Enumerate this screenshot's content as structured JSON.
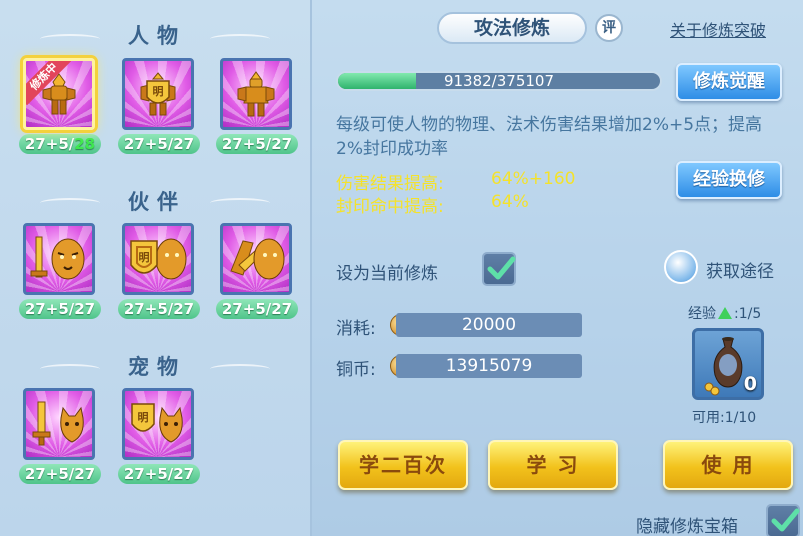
{
  "left": {
    "sections": [
      {
        "title": "人物",
        "items": [
          {
            "level_prefix": "27+5/",
            "level_suffix": "28",
            "badge": "修炼中",
            "selected": true,
            "icon": "warrior-icon"
          },
          {
            "level_prefix": "27+5/",
            "level_suffix": "27",
            "icon": "shield-warrior-icon"
          },
          {
            "level_prefix": "27+5/",
            "level_suffix": "27",
            "icon": "armor-warrior-icon"
          }
        ]
      },
      {
        "title": "伙伴",
        "items": [
          {
            "level_prefix": "27+5/",
            "level_suffix": "27",
            "icon": "tiger-sword-icon"
          },
          {
            "level_prefix": "27+5/",
            "level_suffix": "27",
            "icon": "tiger-shield-icon"
          },
          {
            "level_prefix": "27+5/",
            "level_suffix": "27",
            "icon": "tiger-gauntlet-icon"
          }
        ]
      },
      {
        "title": "宠物",
        "items": [
          {
            "level_prefix": "27+5/",
            "level_suffix": "27",
            "icon": "cat-sword-icon"
          },
          {
            "level_prefix": "27+5/",
            "level_suffix": "27",
            "icon": "cat-shield-icon"
          }
        ]
      }
    ]
  },
  "header": {
    "title": "攻法修炼",
    "eval_badge": "评",
    "breakthrough_link": "关于修炼突破"
  },
  "progress": {
    "text": "91382/375107",
    "current": 91382,
    "max": 375107
  },
  "buttons": {
    "awaken": "修炼觉醒",
    "exchange": "经验换修",
    "learn_200": "学二百次",
    "learn": "学 习",
    "use": "使 用"
  },
  "description": "每级可使人物的物理、法术伤害结果增加2%+5点；提高2%封印成功率",
  "stats": [
    {
      "label": "伤害结果提高:",
      "value": "64%+160"
    },
    {
      "label": "封印命中提高:",
      "value": "64%"
    }
  ],
  "set_current": {
    "label": "设为当前修炼",
    "checked": true
  },
  "get_way": {
    "label": "获取途径"
  },
  "cost": {
    "label": "消耗:",
    "value": "20000"
  },
  "copper": {
    "label": "铜币:",
    "value": "13915079"
  },
  "exp_item": {
    "label_prefix": "经验",
    "label_suffix": ":1/5",
    "count": "0",
    "available": "可用:1/10"
  },
  "hide_chest": {
    "label": "隐藏修炼宝箱",
    "checked": true
  },
  "colors": {
    "accent_gold": "#f2c21c",
    "accent_blue": "#2e8de6",
    "stat_yellow": "#f4e22c",
    "progress_green": "#2fb36d"
  }
}
